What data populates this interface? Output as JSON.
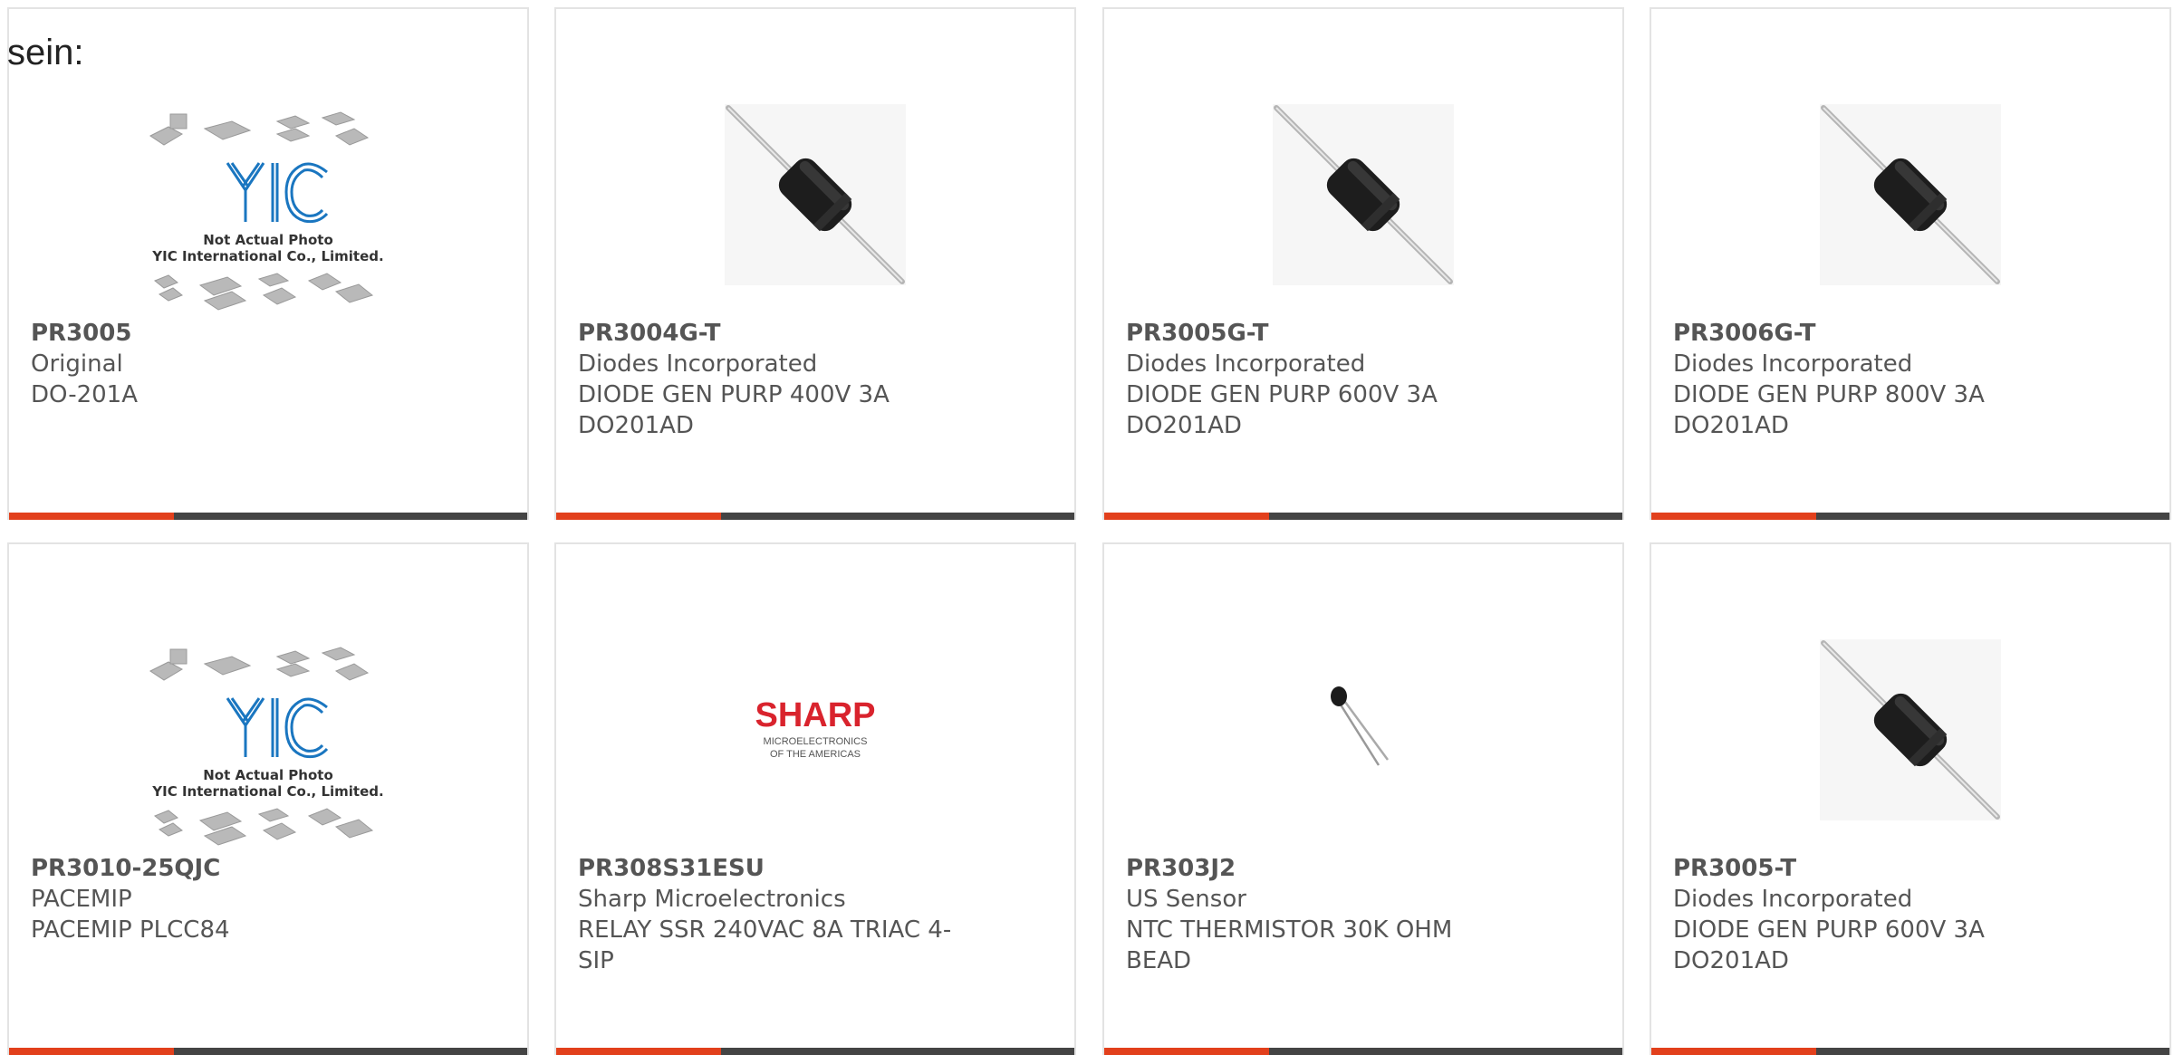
{
  "intro_text": "sein:",
  "accent_color": "#e2401c",
  "bar_color": "#444444",
  "products": [
    {
      "part": "PR3005",
      "maker": "Original",
      "desc1": "DO-201A",
      "desc2": "",
      "image": "yic-not-actual-photo",
      "image_caption_1": "Not Actual Photo",
      "image_caption_2": "YIC International Co., Limited."
    },
    {
      "part": "PR3004G-T",
      "maker": "Diodes Incorporated",
      "desc1": "DIODE GEN PURP 400V 3A",
      "desc2": "DO201AD",
      "image": "axial-diode-photo"
    },
    {
      "part": "PR3005G-T",
      "maker": "Diodes Incorporated",
      "desc1": "DIODE GEN PURP 600V 3A",
      "desc2": "DO201AD",
      "image": "axial-diode-photo"
    },
    {
      "part": "PR3006G-T",
      "maker": "Diodes Incorporated",
      "desc1": "DIODE GEN PURP 800V 3A",
      "desc2": "DO201AD",
      "image": "axial-diode-photo"
    },
    {
      "part": "PR3010-25QJC",
      "maker": "PACEMIP",
      "desc1": "PACEMIP PLCC84",
      "desc2": "",
      "image": "yic-not-actual-photo",
      "image_caption_1": "Not Actual Photo",
      "image_caption_2": "YIC International Co., Limited."
    },
    {
      "part": "PR308S31ESU",
      "maker": "Sharp Microelectronics",
      "desc1": "RELAY SSR 240VAC 8A TRIAC 4-",
      "desc2": "SIP",
      "image": "sharp-logo",
      "logo_text": "SHARP",
      "logo_sub_1": "MICROELECTRONICS",
      "logo_sub_2": "OF THE AMERICAS"
    },
    {
      "part": "PR303J2",
      "maker": "US Sensor",
      "desc1": "NTC THERMISTOR 30K OHM",
      "desc2": "BEAD",
      "image": "thermistor-photo"
    },
    {
      "part": "PR3005-T",
      "maker": "Diodes Incorporated",
      "desc1": "DIODE GEN PURP 600V 3A",
      "desc2": "DO201AD",
      "image": "axial-diode-photo"
    }
  ]
}
